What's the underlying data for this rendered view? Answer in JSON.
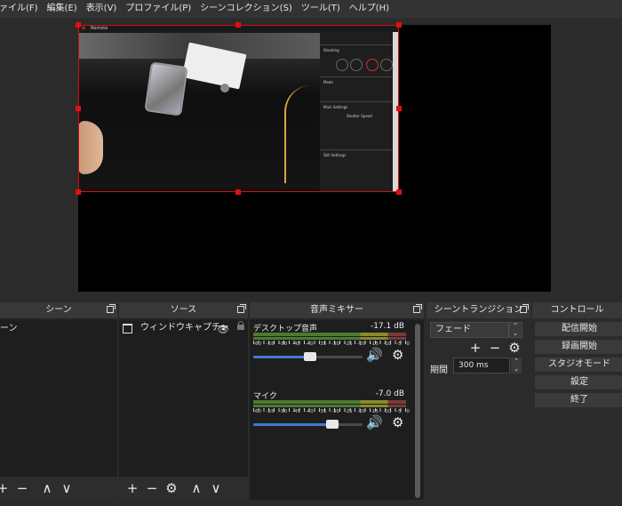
{
  "menu": [
    "ァイル(F)",
    "編集(E)",
    "表示(V)",
    "プロファイル(P)",
    "シーンコレクション(S)",
    "ツール(T)",
    "ヘルプ(H)"
  ],
  "preview": {
    "overlay_text": "Remote",
    "cam_panel": [
      "Shooting",
      "Mode",
      "Main Settings",
      "Shutter Speed",
      "Sub Settings",
      "Still Settings"
    ]
  },
  "scenes": {
    "title": "シーン",
    "items": [
      "ーン"
    ]
  },
  "sources": {
    "title": "ソース",
    "items": [
      {
        "label": "ウィンドウキャプチャ",
        "visible_icon": "eye-icon",
        "lock_icon": "lock-icon"
      }
    ]
  },
  "mixer": {
    "title": "音声ミキサー",
    "channels": [
      {
        "name": "デスクトップ音声",
        "db": "-17.1 dB",
        "volume": 0.52
      },
      {
        "name": "マイク",
        "db": "-7.0 dB",
        "volume": 0.72
      }
    ],
    "scale": [
      "-60",
      "-55",
      "-50",
      "-45",
      "-40",
      "-35",
      "-30",
      "-25",
      "-20",
      "-15",
      "-10",
      "-5",
      "0"
    ]
  },
  "transitions": {
    "title": "シーントランジション",
    "selected": "フェード",
    "duration_label": "期間",
    "duration_value": "300 ms"
  },
  "controls": {
    "title": "コントロール",
    "buttons": [
      "配信開始",
      "録画開始",
      "スタジオモード",
      "設定",
      "終了"
    ]
  },
  "colors": {
    "selection": "#d01010",
    "volume_fill": "#3b7fd1"
  }
}
